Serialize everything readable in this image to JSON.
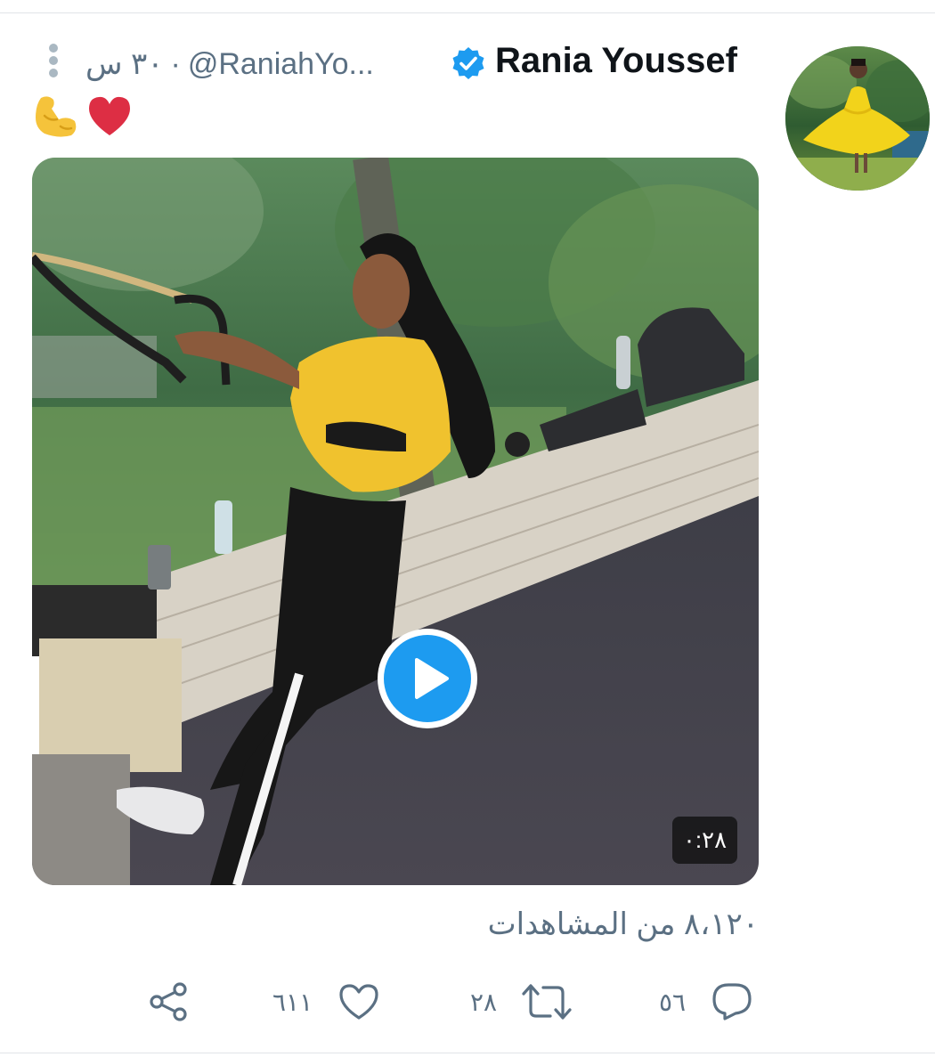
{
  "tweet": {
    "display_name": "Rania Youssef",
    "handle": "@RaniahYo...",
    "time_ago": "٣٠ س",
    "separator": "·",
    "text_emoji": "💪❤️",
    "views_text": "٨،١٢٠ من المشاهدات",
    "video_duration": "٠:٢٨"
  },
  "actions": {
    "replies": "٥٦",
    "retweets": "٢٨",
    "likes": "٦١١"
  },
  "icons": {
    "more": "vertical-dots-icon",
    "verified": "verified-badge-icon",
    "play": "play-icon",
    "share": "share-icon",
    "like": "heart-icon",
    "retweet": "retweet-icon",
    "reply": "reply-bubble-icon"
  },
  "colors": {
    "accent": "#1d9bf0",
    "muted": "#5b7083",
    "heart": "#e0245e",
    "muscle": "#f5c33b"
  }
}
